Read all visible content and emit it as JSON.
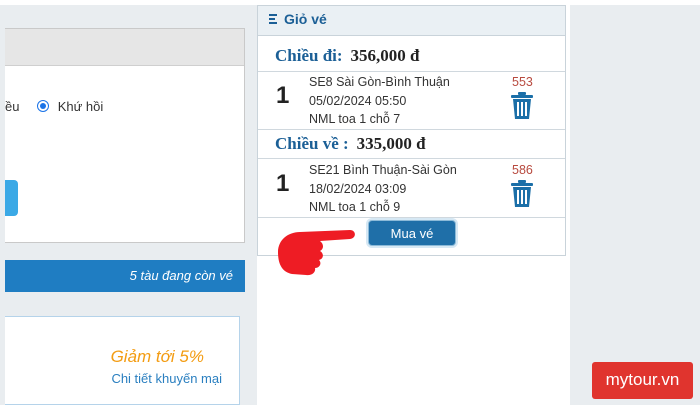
{
  "search_form": {
    "trip_type_one_way_tail": "ều",
    "trip_type_round_trip": "Khứ hồi"
  },
  "status_bar": {
    "text": "5 tàu đang còn vé"
  },
  "promo": {
    "title": "Giảm tới 5%",
    "link": "Chi tiết khuyến mại"
  },
  "cart": {
    "title": "Giỏ vé",
    "outbound": {
      "label": "Chiều đi:",
      "price": "356,000 đ",
      "ticket": {
        "qty": "1",
        "route": "SE8 Sài Gòn-Bình Thuận",
        "datetime": "05/02/2024 05:50",
        "seat": "NML toa 1 chỗ 7",
        "code": "553"
      }
    },
    "return": {
      "label": "Chiều về :",
      "price": "335,000 đ",
      "ticket": {
        "qty": "1",
        "route": "SE21 Bình Thuận-Sài Gòn",
        "datetime": "18/02/2024 03:09",
        "seat": "NML toa 1 chỗ 9",
        "code": "586"
      }
    },
    "buy_button": "Mua vé"
  },
  "watermark": {
    "text": "mytour.vn"
  },
  "icons": {
    "cart_header": "list-icon",
    "delete": "trash-icon",
    "pointer": "pointing-hand-icon"
  },
  "colors": {
    "accent_blue": "#1f7dc2",
    "heading_blue": "#1b5f96",
    "promo_orange": "#f39c12",
    "ticket_code_red": "#b84a3f",
    "watermark_red": "#e0342e"
  }
}
